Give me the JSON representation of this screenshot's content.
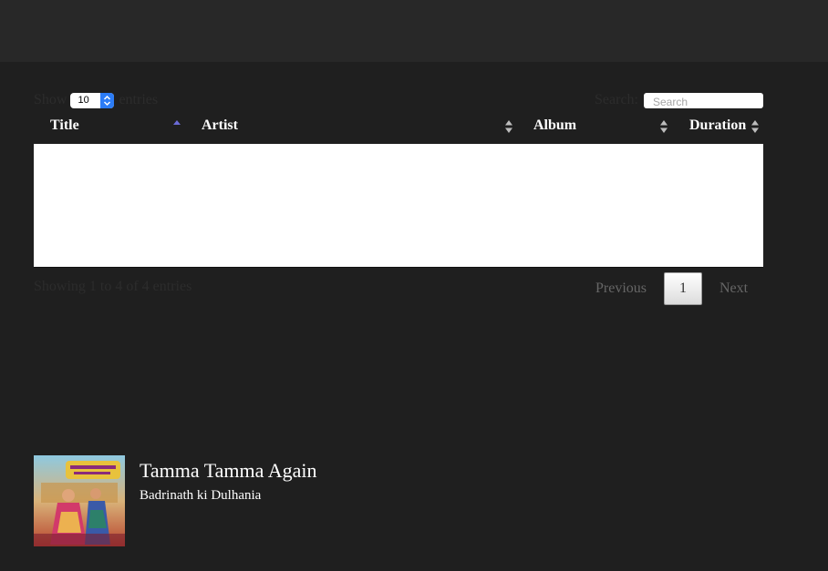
{
  "table_controls": {
    "show_label": "Show",
    "page_length": "10",
    "entries_label": "entries",
    "search_label": "Search:",
    "search_placeholder": "Search",
    "search_value": ""
  },
  "table": {
    "columns": [
      {
        "label": "Title",
        "sort": "ascending"
      },
      {
        "label": "Artist",
        "sort": "both"
      },
      {
        "label": "Album",
        "sort": "both"
      },
      {
        "label": "Duration",
        "sort": "both"
      }
    ],
    "rows": []
  },
  "table_footer": {
    "info": "Showing 1 to 4 of 4 entries",
    "previous_label": "Previous",
    "current_page": "1",
    "next_label": "Next"
  },
  "now_playing": {
    "title": "Tamma Tamma Again",
    "album": "Badrinath ki Dulhania",
    "cover_icon": "album-cover-image"
  },
  "colors": {
    "background": "#1f1f1f",
    "topbar": "#282828",
    "sort_active": "#6b6bd6",
    "sort_inactive": "#bdbdbd",
    "select_accent": "#2c7cf6"
  }
}
